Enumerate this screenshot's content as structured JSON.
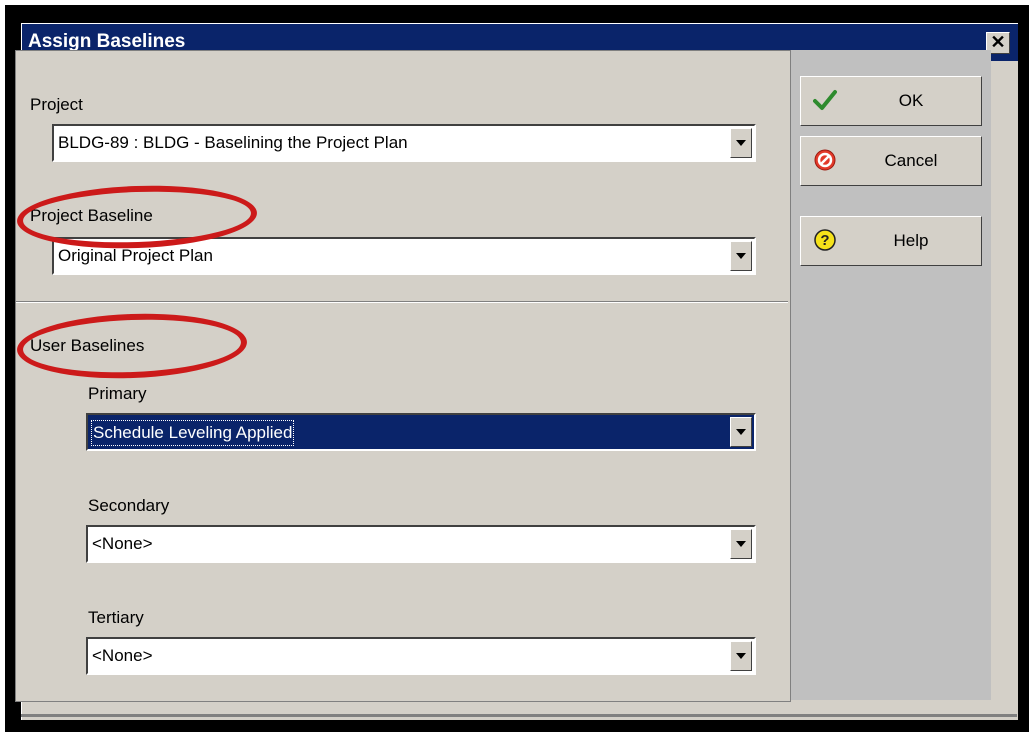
{
  "window": {
    "title": "Assign Baselines",
    "close_label": "✕"
  },
  "project": {
    "label": "Project",
    "value": "BLDG-89 : BLDG - Baselining the Project Plan"
  },
  "project_baseline": {
    "label": "Project Baseline",
    "value": "Original Project Plan"
  },
  "user_baselines": {
    "label": "User Baselines",
    "primary": {
      "label": "Primary",
      "value": "Schedule Leveling Applied"
    },
    "secondary": {
      "label": "Secondary",
      "value": "<None>"
    },
    "tertiary": {
      "label": "Tertiary",
      "value": "<None>"
    }
  },
  "buttons": {
    "ok": "OK",
    "cancel": "Cancel",
    "help": "Help"
  },
  "colors": {
    "titlebar": "#0a246a",
    "annotation": "#cc1a1a",
    "dialog_bg": "#d4d0c8"
  },
  "icons": {
    "ok": "checkmark-icon",
    "cancel": "no-entry-icon",
    "help": "question-icon"
  }
}
